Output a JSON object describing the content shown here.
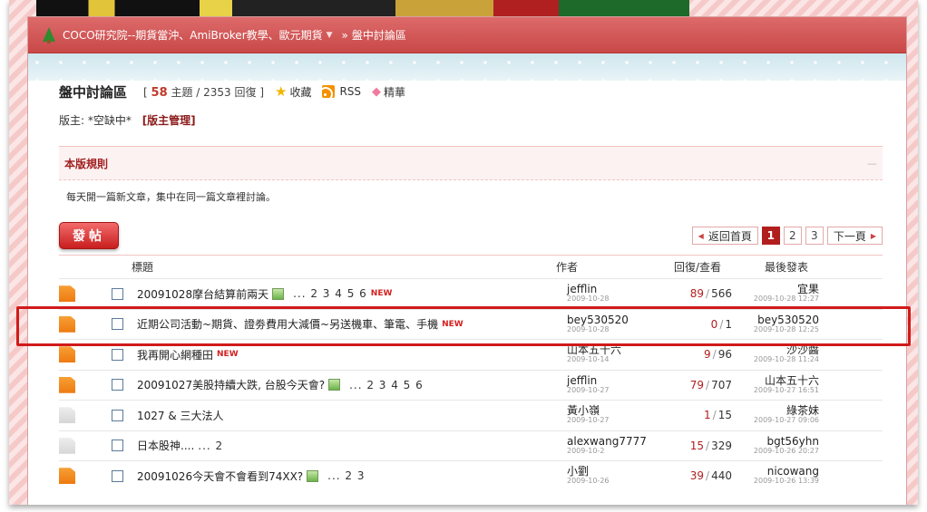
{
  "breadcrumb": {
    "site": "COCO研究院--期貨當沖、AmiBroker教學、歐元期貨",
    "sep": "»",
    "current": "盤中討論區"
  },
  "forum": {
    "title": "盤中討論區",
    "stats_open": "[",
    "topics": "58",
    "topics_label": "主題 / 2353 回復",
    "stats_close": "]",
    "favorite": "收藏",
    "rss": "RSS",
    "digest": "精華"
  },
  "moderator": {
    "label": "版主: *空缺中*",
    "manage": "[版主管理]"
  },
  "rules": {
    "title": "本版規則",
    "collapse": "—",
    "text": "每天開一篇新文章，集中在同一篇文章裡討論。"
  },
  "actions": {
    "post": "發帖",
    "back": "返回首頁",
    "pages": [
      "1",
      "2",
      "3"
    ],
    "next": "下一頁"
  },
  "table": {
    "headers": {
      "title": "標題",
      "author": "作者",
      "reply": "回復/查看",
      "last": "最後發表"
    },
    "rows": [
      {
        "title": "20091028摩台結算前兩天",
        "pages": "... 2 3 4 5 6",
        "new": "NEW",
        "author": "jefflin",
        "author_date": "2009-10-28",
        "replies": "89",
        "views": "566",
        "last": "宜果",
        "last_date": "2009-10-28 12:27"
      },
      {
        "title": "近期公司活動~期貨、證劵費用大減價~另送機車、筆電、手機",
        "pages": "",
        "new": "NEW",
        "author": "bey530520",
        "author_date": "2009-10-28",
        "replies": "0",
        "views": "1",
        "last": "bey530520",
        "last_date": "2009-10-28 12:25"
      },
      {
        "title": "我再開心網種田",
        "pages": "",
        "new": "NEW",
        "author": "山本五十六",
        "author_date": "2009-10-14",
        "replies": "9",
        "views": "96",
        "last": "沙沙醬",
        "last_date": "2009-10-28 11:24"
      },
      {
        "title": "20091027美股持續大跌, 台股今天會?",
        "pages": "... 2 3 4 5 6",
        "new": "",
        "author": "jefflin",
        "author_date": "2009-10-27",
        "replies": "79",
        "views": "707",
        "last": "山本五十六",
        "last_date": "2009-10-27 16:51"
      },
      {
        "title": "1027 & 三大法人",
        "pages": "",
        "new": "",
        "author": "黃小嶺",
        "author_date": "2009-10-27",
        "replies": "1",
        "views": "15",
        "last": "綠茶妹",
        "last_date": "2009-10-27 09:06"
      },
      {
        "title": "日本股神....",
        "pages": "... 2",
        "new": "",
        "author": "alexwang7777",
        "author_date": "2009-10-2",
        "replies": "15",
        "views": "329",
        "last": "bgt56yhn",
        "last_date": "2009-10-26 20:27"
      },
      {
        "title": "20091026今天會不會看到74XX?",
        "pages": "... 2 3",
        "new": "",
        "author": "小劉",
        "author_date": "2009-10-26",
        "replies": "39",
        "views": "440",
        "last": "nicowang",
        "last_date": "2009-10-26 13:39"
      }
    ]
  },
  "colors": {
    "accent": "#c94848",
    "highlight": "#d11a1a"
  }
}
